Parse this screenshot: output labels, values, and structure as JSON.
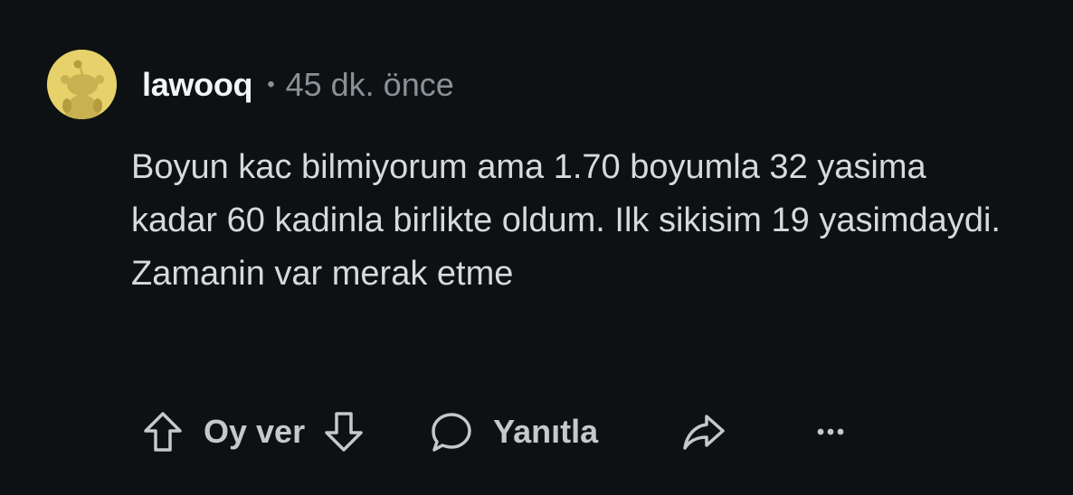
{
  "comment": {
    "username": "lawooq",
    "separator": "•",
    "time": "45 dk. önce",
    "body": "Boyun kac bilmiyorum ama 1.70 boyumla 32 yasima kadar 60 kadinla birlikte oldum. Ilk sikisim 19 yasimdaydi. Zamanin var merak etme"
  },
  "actions": {
    "vote_label": "Oy ver",
    "reply_label": "Yanıtla",
    "upvote_icon": "arrow-up-icon",
    "downvote_icon": "arrow-down-icon",
    "reply_icon": "speech-bubble-icon",
    "share_icon": "share-arrow-icon",
    "more_icon": "ellipsis-icon"
  },
  "colors": {
    "background": "#0e1113",
    "text": "#d7dadc",
    "muted": "#8a9196",
    "avatar_bg": "#e6d16a"
  }
}
